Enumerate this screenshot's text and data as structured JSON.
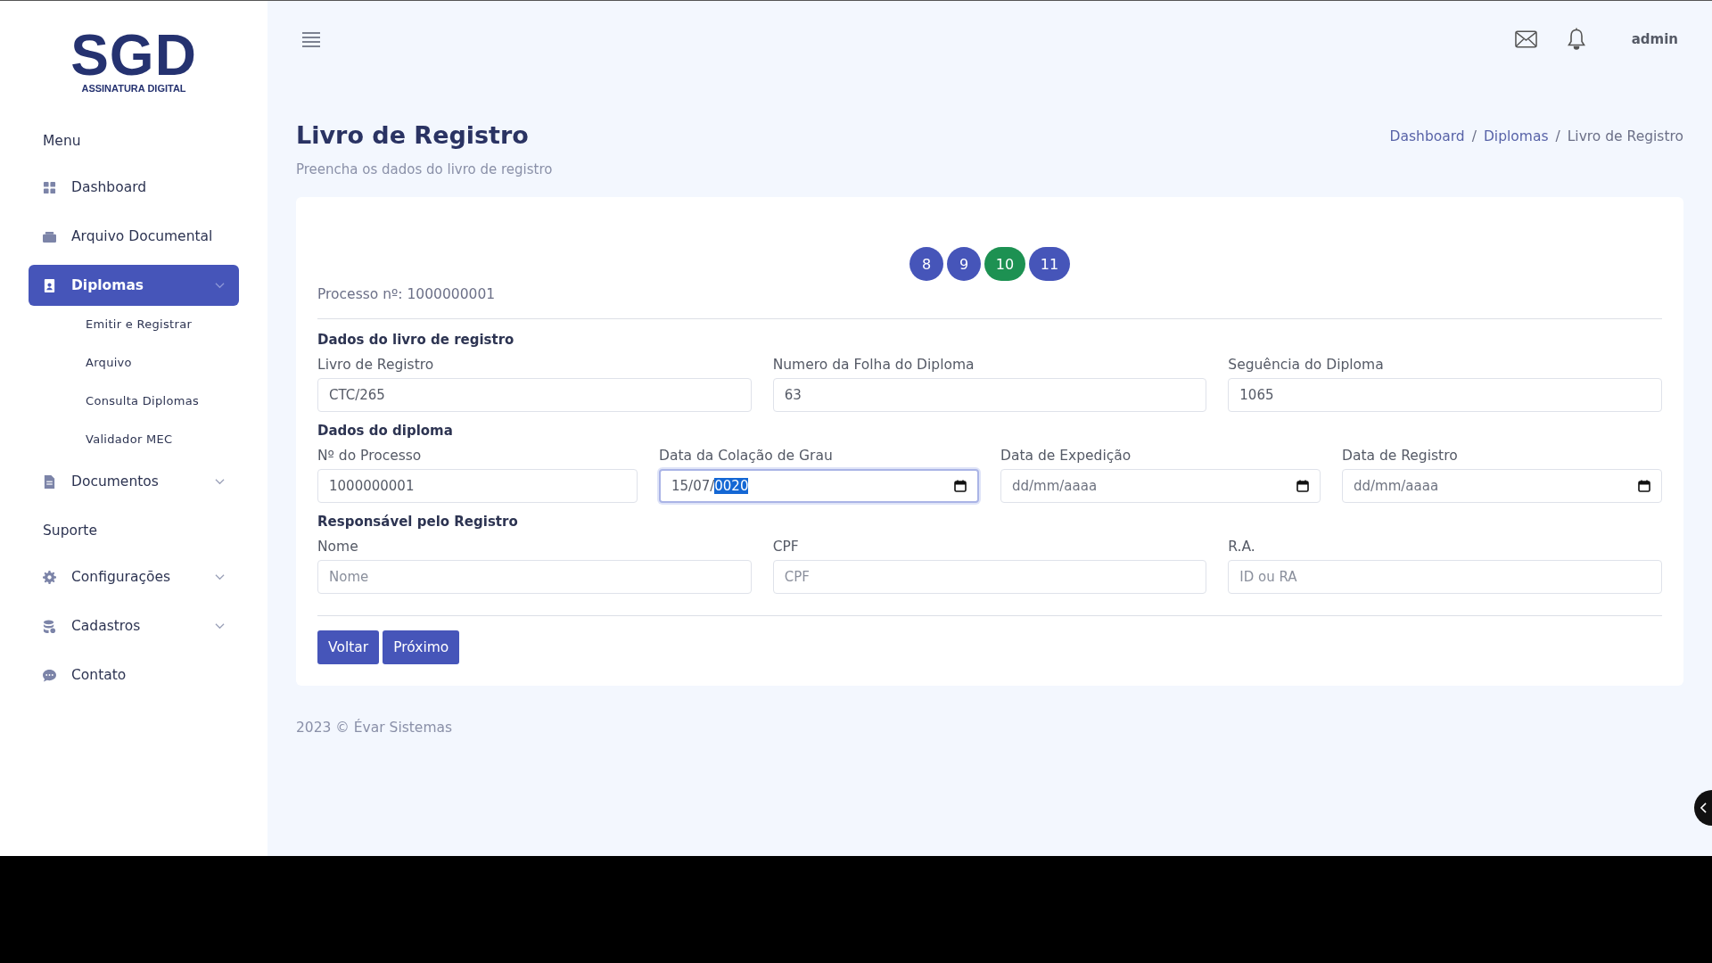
{
  "sidebar": {
    "logo": {
      "title": "SGD",
      "subtitle": "ASSINATURA DIGITAL"
    },
    "sections": [
      {
        "title": "Menu",
        "items": [
          {
            "label": "Dashboard",
            "selected": false,
            "kind": "link"
          },
          {
            "label": "Arquivo Documental",
            "selected": false,
            "kind": "link"
          },
          {
            "label": "Diplomas",
            "selected": true,
            "kind": "group",
            "children": [
              {
                "label": "Emitir e Registrar"
              },
              {
                "label": "Arquivo"
              },
              {
                "label": "Consulta Diplomas"
              },
              {
                "label": "Validador MEC"
              }
            ]
          },
          {
            "label": "Documentos",
            "selected": false,
            "kind": "group"
          }
        ]
      },
      {
        "title": "Suporte",
        "items": [
          {
            "label": "Configurações",
            "selected": false,
            "kind": "group"
          },
          {
            "label": "Cadastros",
            "selected": false,
            "kind": "group"
          },
          {
            "label": "Contato",
            "selected": false,
            "kind": "link"
          }
        ]
      }
    ]
  },
  "header": {
    "user": "admin"
  },
  "page": {
    "title": "Livro de Registro",
    "subtitle": "Preencha os dados do livro de registro",
    "breadcrumb": [
      {
        "label": "Dashboard",
        "current": false
      },
      {
        "separator": "/",
        "label": "Diplomas",
        "current": false
      },
      {
        "separator": "/",
        "label": "Livro de Registro",
        "current": true
      }
    ]
  },
  "steps": [
    {
      "label": "8",
      "selected": false
    },
    {
      "label": "9",
      "selected": false
    },
    {
      "label": "10",
      "selected": true
    },
    {
      "label": "11",
      "selected": false
    }
  ],
  "process_number": "Processo nº: 1000000001",
  "groups": [
    {
      "title": "Dados do livro de registro",
      "fields": [
        {
          "kind": "text",
          "label": "Livro de Registro",
          "value": "CTC/265"
        },
        {
          "kind": "text",
          "label": "Numero da Folha do Diploma",
          "value": "63"
        },
        {
          "kind": "text",
          "label": "Seguência do Diploma",
          "value": "1065"
        }
      ]
    },
    {
      "title": "Dados do diploma",
      "fields": [
        {
          "kind": "text",
          "label": "Nº do Processo",
          "value": "1000000001"
        },
        {
          "kind": "date",
          "label": "Data da Colação de Grau",
          "value": "15/07/",
          "selected_text": "0020",
          "focused": true
        },
        {
          "kind": "date",
          "label": "Data de Expedição",
          "placeholder": "dd/mm/aaaa",
          "focused": false
        },
        {
          "kind": "date",
          "label": "Data de Registro",
          "placeholder": "dd/mm/aaaa",
          "focused": false
        }
      ]
    },
    {
      "title": "Responsável pelo Registro",
      "fields": [
        {
          "kind": "text",
          "label": "Nome",
          "placeholder": "Nome"
        },
        {
          "kind": "text",
          "label": "CPF",
          "placeholder": "CPF"
        },
        {
          "kind": "text",
          "label": "R.A.",
          "placeholder": "ID ou RA"
        }
      ]
    }
  ],
  "buttons": [
    "Voltar",
    "Próximo"
  ],
  "footer": "2023 © Évar Sistemas"
}
